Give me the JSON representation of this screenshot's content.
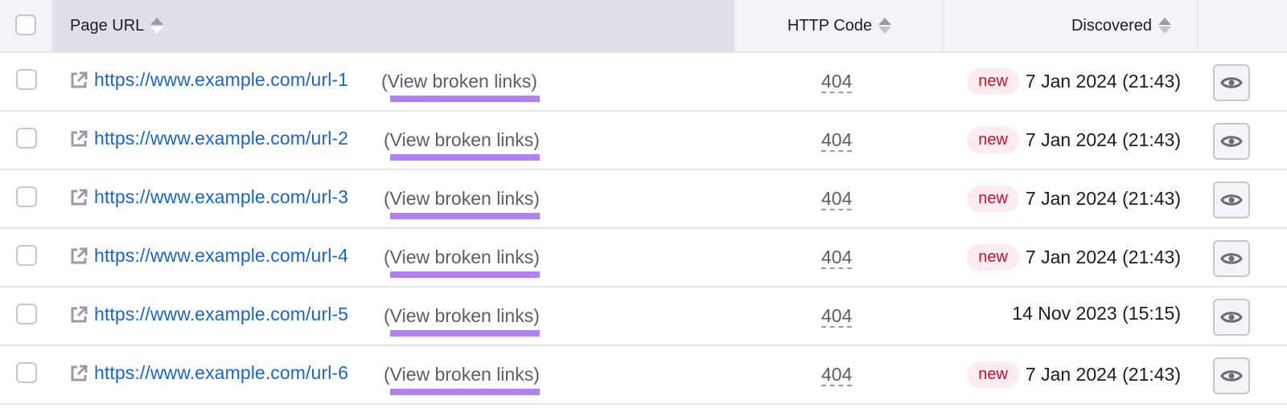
{
  "table": {
    "headers": {
      "page_url": "Page URL",
      "http_code": "HTTP Code",
      "discovered": "Discovered"
    },
    "rows": [
      {
        "url": "https://www.example.com/url-1",
        "view_label": "(View broken links)",
        "code": "404",
        "badge": "new",
        "date": "7 Jan 2024 (21:43)"
      },
      {
        "url": "https://www.example.com/url-2",
        "view_label": "(View broken links)",
        "code": "404",
        "badge": "new",
        "date": "7 Jan 2024 (21:43)"
      },
      {
        "url": "https://www.example.com/url-3",
        "view_label": "(View broken links)",
        "code": "404",
        "badge": "new",
        "date": "7 Jan 2024 (21:43)"
      },
      {
        "url": "https://www.example.com/url-4",
        "view_label": "(View broken links)",
        "code": "404",
        "badge": "new",
        "date": "7 Jan 2024 (21:43)"
      },
      {
        "url": "https://www.example.com/url-5",
        "view_label": "(View broken links)",
        "code": "404",
        "badge": null,
        "date": "14 Nov 2023 (15:15)"
      },
      {
        "url": "https://www.example.com/url-6",
        "view_label": "(View broken links)",
        "code": "404",
        "badge": "new",
        "date": "7 Jan 2024 (21:43)"
      }
    ]
  },
  "colors": {
    "link": "#1a66c2",
    "highlight": "#b27ff5",
    "badge_bg": "#fdecef",
    "badge_text": "#c8102e"
  }
}
